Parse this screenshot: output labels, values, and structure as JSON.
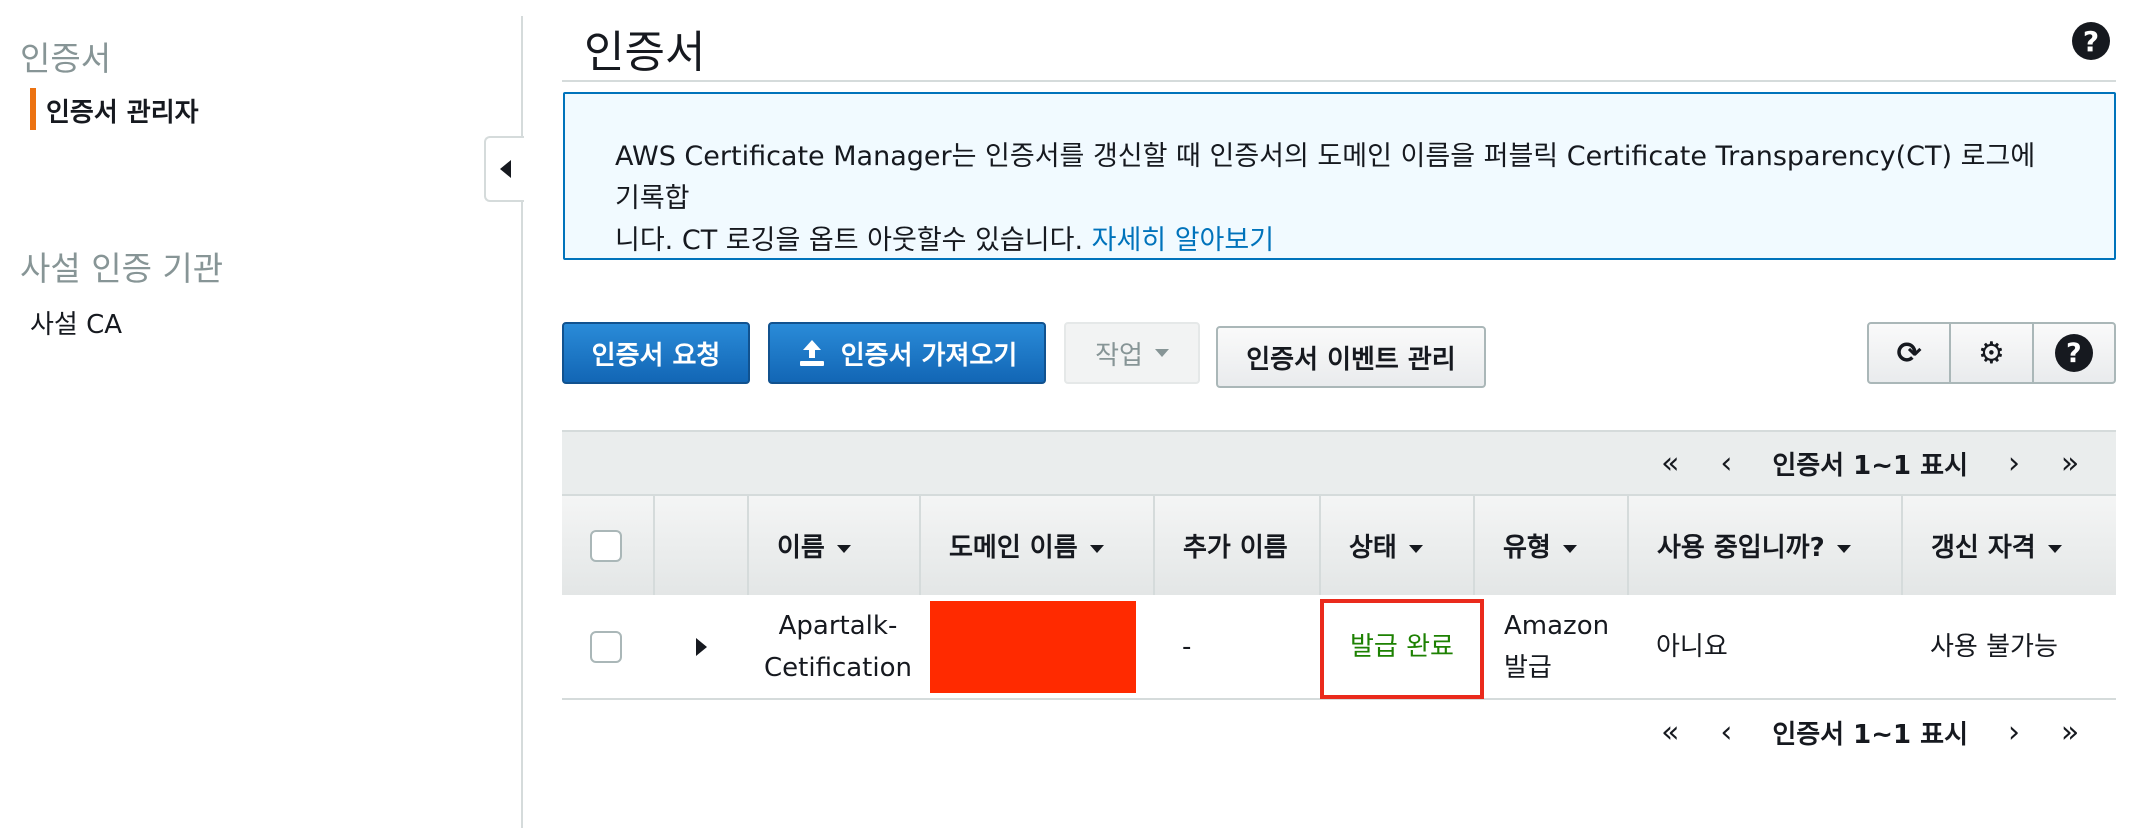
{
  "sidebar": {
    "section1_title": "인증서",
    "item_cert_manager": "인증서 관리자",
    "section2_title": "사설 인증 기관",
    "item_private_ca": "사설 CA"
  },
  "header": {
    "title": "인증서",
    "help_symbol": "?"
  },
  "info": {
    "line1": "AWS Certificate Manager는 인증서를 갱신할 때 인증서의 도메인 이름을 퍼블릭 Certificate Transparency(CT) 로그에 기록합",
    "line2": "니다. CT 로깅을 옵트 아웃할수 있습니다. ",
    "link": "자세히 알아보기"
  },
  "toolbar": {
    "request_label": "인증서 요청",
    "import_label": "인증서 가져오기",
    "actions_label": "작업",
    "events_label": "인증서 이벤트 관리",
    "refresh_symbol": "⟳",
    "settings_symbol": "⚙",
    "help_symbol": "?"
  },
  "pagination": {
    "text": "인증서 1~1 표시",
    "first": "«",
    "prev": "‹",
    "next": "›",
    "last": "»"
  },
  "table": {
    "columns": [
      "이름",
      "도메인 이름",
      "추가 이름",
      "상태",
      "유형",
      "사용 중입니까?",
      "갱신 자격"
    ],
    "rows": [
      {
        "name_line1": "Apartalk-",
        "name_line2": "Cetification",
        "additional_names": "-",
        "status": "발급 완료",
        "type_line1": "Amazon",
        "type_line2": "발급",
        "in_use": "아니요",
        "renewal": "사용 불가능"
      }
    ]
  },
  "colors": {
    "primary": "#1266b5",
    "accent": "#ec7211",
    "status_issued": "#1d8102",
    "info_border": "#0073bb",
    "redaction": "#ff2a00",
    "highlight_box": "#ea2a1c"
  },
  "icons": [
    "collapse-left-icon",
    "upload-icon",
    "refresh-icon",
    "gear-icon",
    "help-icon",
    "expand-right-icon"
  ]
}
